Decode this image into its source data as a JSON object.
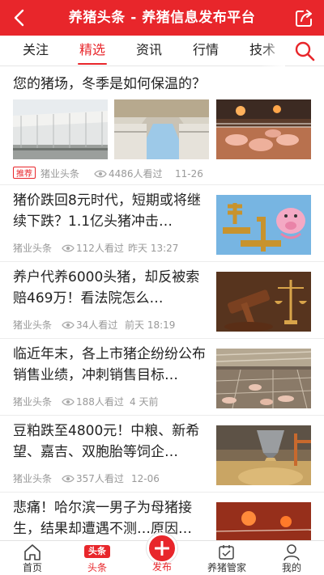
{
  "header": {
    "title": "养猪头条 - 养猪信息发布平台",
    "back_icon": "back-arrow-icon",
    "share_icon": "share-icon"
  },
  "tabs": {
    "items": [
      "关注",
      "精选",
      "资讯",
      "行情",
      "技术"
    ],
    "active": "精选",
    "search_icon": "search-icon"
  },
  "feed": {
    "featured": {
      "title": "您的猪场，冬季是如何保温的？",
      "badge": "推荐",
      "source": "猪业头条",
      "views": "4486人看过",
      "time": "11-26"
    },
    "articles": [
      {
        "title": "猪价跌回8元时代，短期或将继续下跌？1.1亿头猪冲击…",
        "source": "猪业头条",
        "views": "112人看过",
        "time": "昨天 13:27"
      },
      {
        "title": "养户代养6000头猪，却反被索赔469万！看法院怎么…",
        "source": "猪业头条",
        "views": "34人看过",
        "time": "前天 18:19"
      },
      {
        "title": "临近年末，各上市猪企纷纷公布销售业绩，冲刺销售目标…",
        "source": "猪业头条",
        "views": "188人看过",
        "time": "4 天前"
      },
      {
        "title": "豆粕跌至4800元！中粮、新希望、嘉吉、双胞胎等饲企…",
        "source": "猪业头条",
        "views": "357人看过",
        "time": "12-06"
      },
      {
        "title": "悲痛！哈尔滨一男子为母猪接生，结果却遭遇不测…原因…",
        "source": "",
        "views": "",
        "time": ""
      }
    ]
  },
  "bottom_nav": {
    "items": [
      {
        "label": "首页",
        "icon": "home-icon"
      },
      {
        "label": "头条",
        "icon": "headline-badge-icon",
        "badge": "头条"
      },
      {
        "label": "发布",
        "icon": "plus-icon"
      },
      {
        "label": "养猪管家",
        "icon": "calendar-manager-icon"
      },
      {
        "label": "我的",
        "icon": "person-icon"
      }
    ],
    "active": "头条"
  },
  "colors": {
    "brand": "#e8262b",
    "meta_text": "#999999"
  }
}
